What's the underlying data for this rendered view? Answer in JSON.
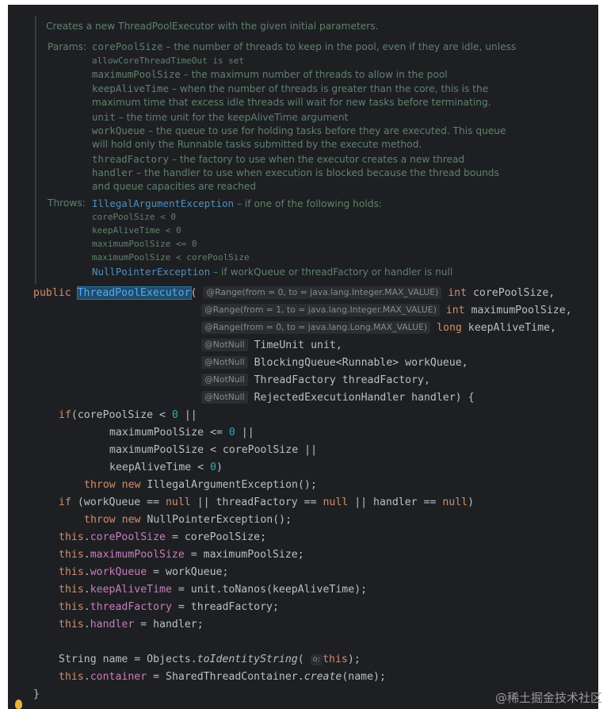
{
  "doc": {
    "intro": "Creates a new ThreadPoolExecutor with the given initial parameters.",
    "params_label": "Params:",
    "throws_label": "Throws:",
    "params": [
      {
        "name": "corePoolSize",
        "desc": " – the number of threads to keep in the pool, even if they are idle, unless",
        "cont": "allowCoreThreadTimeOut is set"
      },
      {
        "name": "maximumPoolSize",
        "desc": " – the maximum number of threads to allow in the pool"
      },
      {
        "name": "keepAliveTime",
        "desc": " – when the number of threads is greater than the core, this is the",
        "cont": "maximum time that excess idle threads will wait for new tasks before terminating."
      },
      {
        "name": "unit",
        "desc": " – the time unit for the keepAliveTime argument"
      },
      {
        "name": "workQueue",
        "desc": " – the queue to use for holding tasks before they are executed. This queue",
        "cont": "will hold only the Runnable tasks submitted by the execute method."
      },
      {
        "name": "threadFactory",
        "desc": " – the factory to use when the executor creates a new thread"
      },
      {
        "name": "handler",
        "desc": " – the handler to use when execution is blocked because the thread bounds",
        "cont": "and queue capacities are reached"
      }
    ],
    "throws": [
      {
        "name": "IllegalArgumentException",
        "desc": " – if one of the following holds:"
      },
      {
        "cond": "corePoolSize < 0"
      },
      {
        "cond": "keepAliveTime < 0"
      },
      {
        "cond": "maximumPoolSize <= 0"
      },
      {
        "cond": "maximumPoolSize < corePoolSize"
      },
      {
        "name": "NullPointerException",
        "desc": " – if workQueue or threadFactory or handler is null"
      }
    ]
  },
  "code": {
    "public_kw": "public",
    "ctor_name": "ThreadPoolExecutor",
    "open_paren": "(",
    "annotations": [
      "@Range(from = 0, to = java.lang.Integer.MAX_VALUE)",
      "@Range(from = 1, to = java.lang.Integer.MAX_VALUE)",
      "@Range(from = 0, to = java.lang.Long.MAX_VALUE)",
      "@NotNull",
      "@NotNull",
      "@NotNull",
      "@NotNull"
    ],
    "params": [
      {
        "type": "int",
        "type_kw": true,
        "name": "corePoolSize,"
      },
      {
        "type": "int",
        "type_kw": true,
        "name": "maximumPoolSize,"
      },
      {
        "type": "long",
        "type_kw": true,
        "name": "keepAliveTime,"
      },
      {
        "type": "TimeUnit",
        "type_kw": false,
        "name": "unit,"
      },
      {
        "type": "BlockingQueue<Runnable>",
        "type_kw": false,
        "name": "workQueue,"
      },
      {
        "type": "ThreadFactory",
        "type_kw": false,
        "name": "threadFactory,"
      },
      {
        "type": "RejectedExecutionHandler",
        "type_kw": false,
        "name": "handler) {"
      }
    ],
    "hint_label": "o:",
    "watermark": "@稀土掘金技术社区"
  },
  "colors": {
    "background": "#1e1f22",
    "keyword": "#cf8e6d",
    "field": "#c77dbb",
    "number": "#2aacb8",
    "doc_text": "#5f826b",
    "link": "#4f8fbf",
    "default_text": "#bcbec4"
  },
  "icons": [
    "intention-bulb-icon"
  ]
}
